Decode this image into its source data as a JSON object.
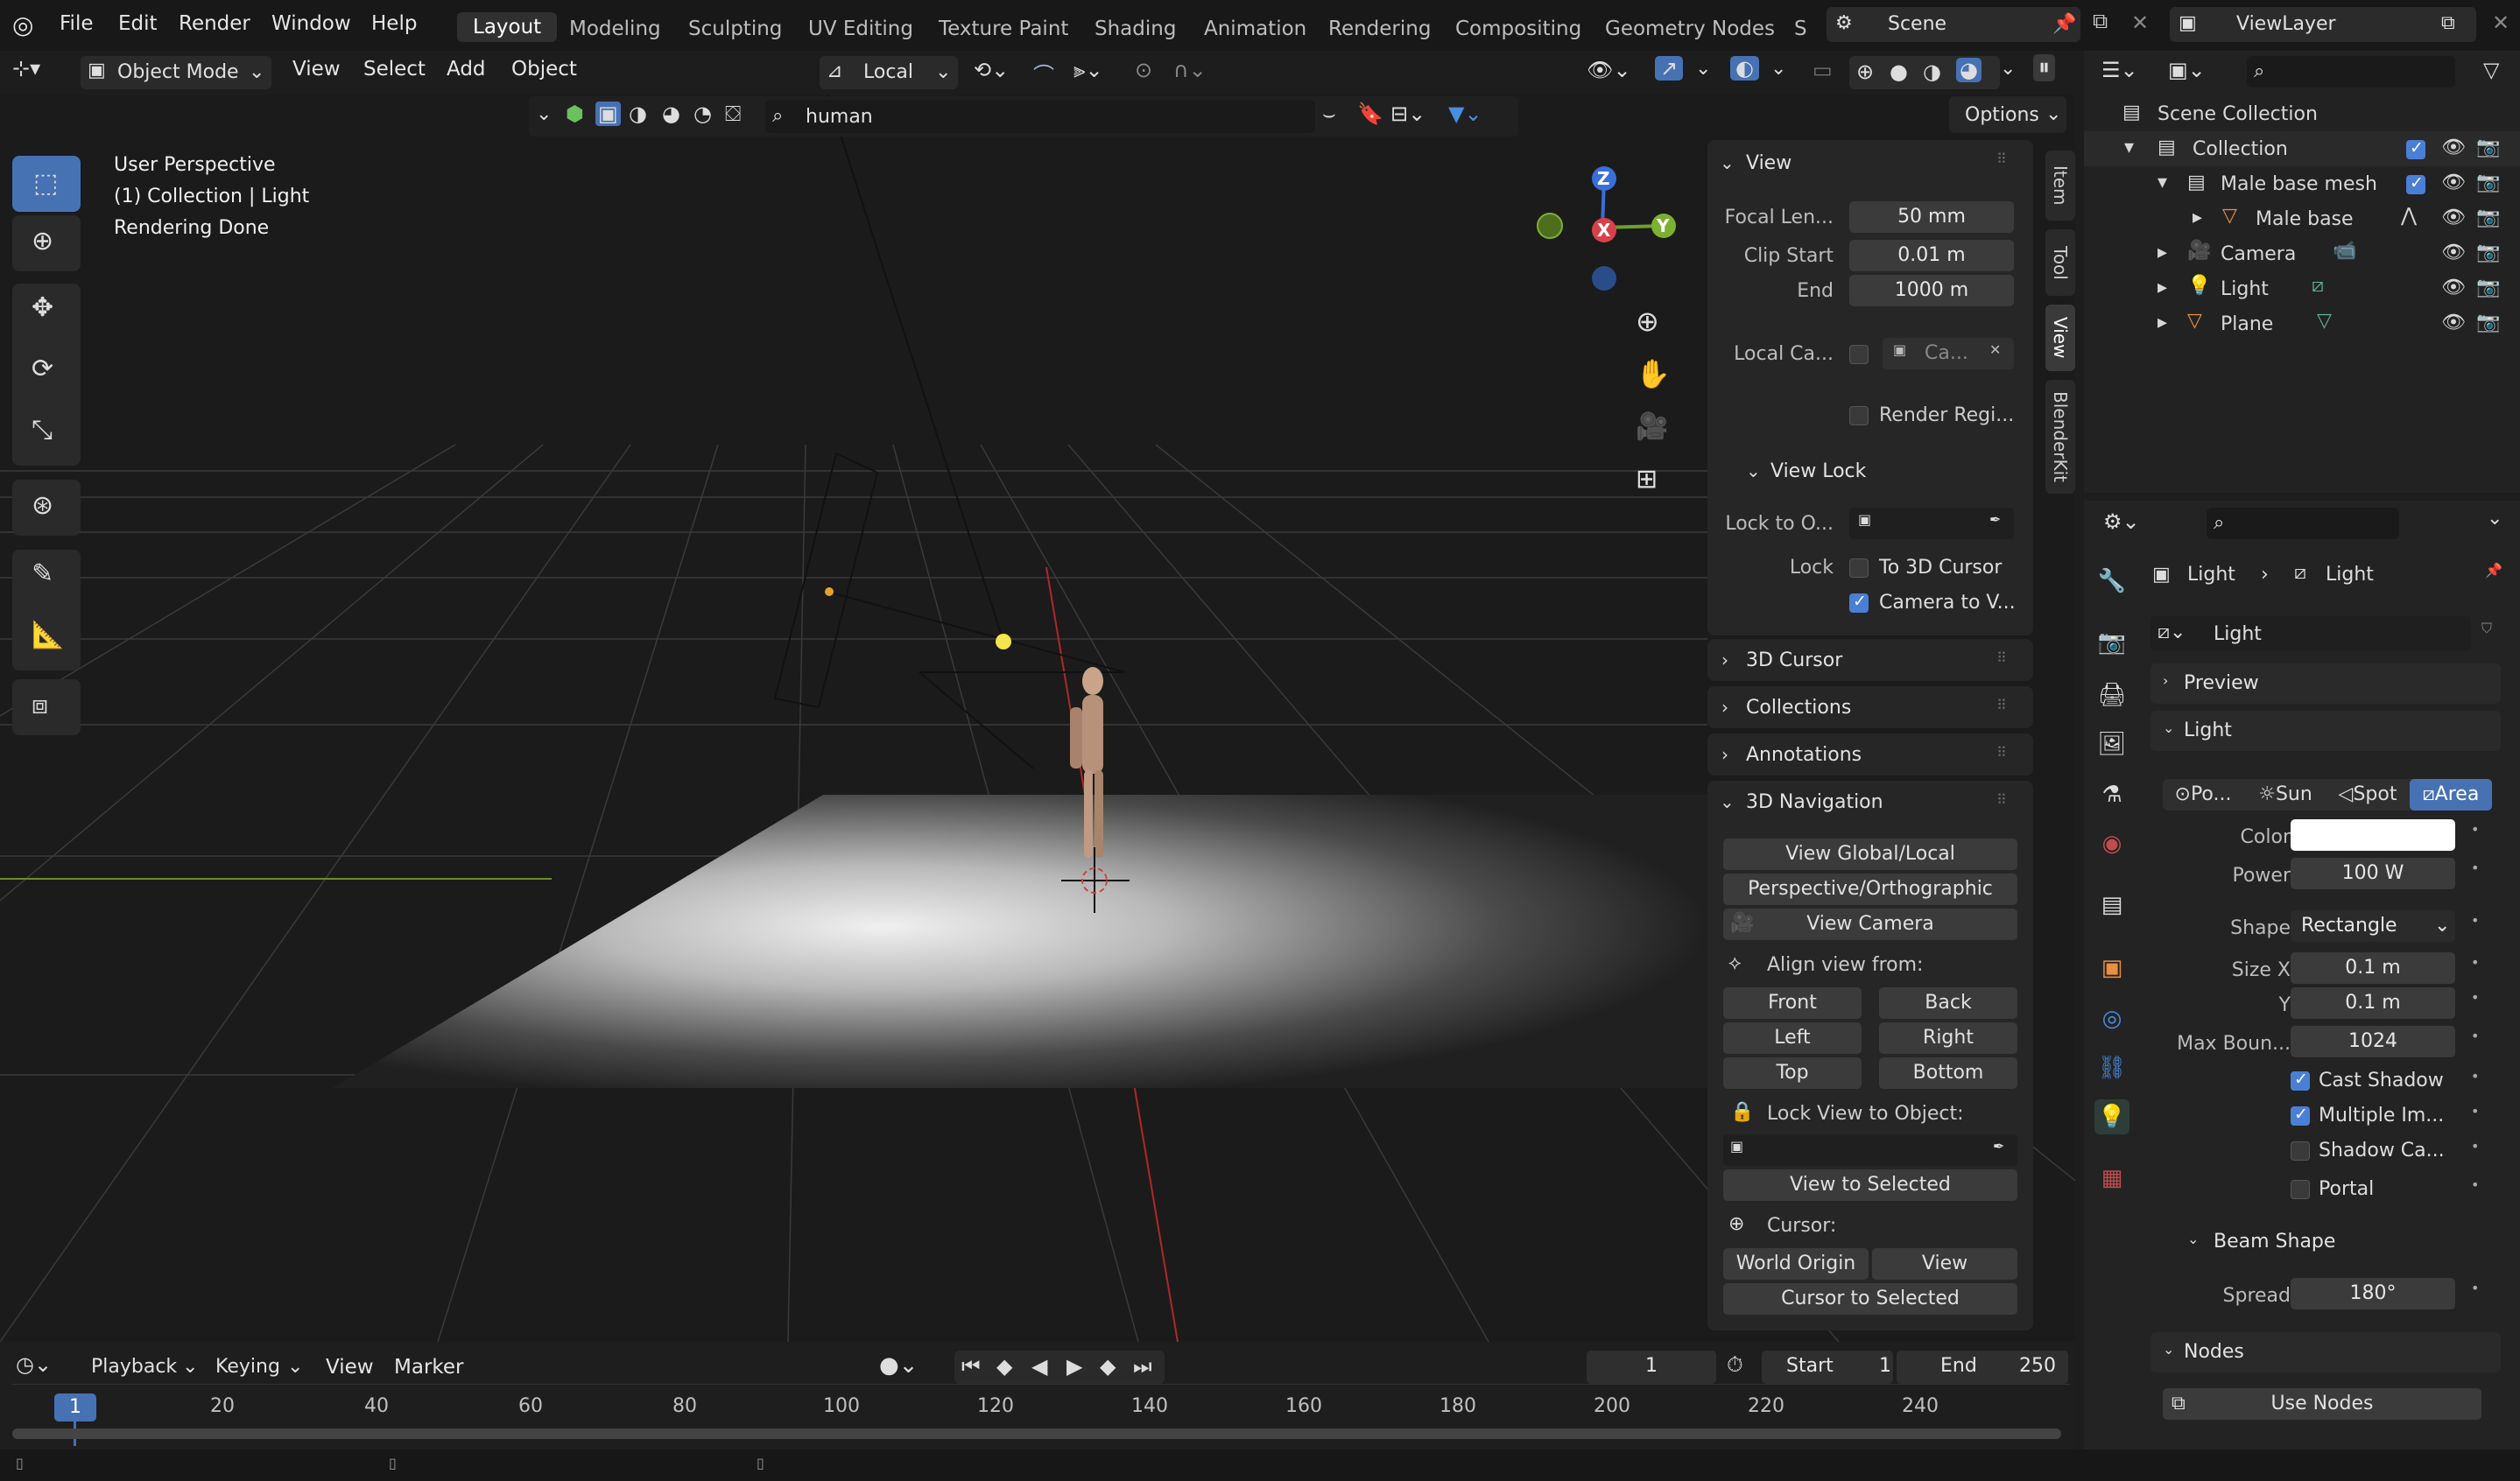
{
  "topbar": {
    "menus": [
      "File",
      "Edit",
      "Render",
      "Window",
      "Help"
    ],
    "workspaces": [
      "Layout",
      "Modeling",
      "Sculpting",
      "UV Editing",
      "Texture Paint",
      "Shading",
      "Animation",
      "Rendering",
      "Compositing",
      "Geometry Nodes",
      "S"
    ],
    "scene": "Scene",
    "view_layer": "ViewLayer"
  },
  "viewport_header": {
    "mode": "Object Mode",
    "menus": [
      "View",
      "Select",
      "Add",
      "Object"
    ],
    "transform_orientation": "Local",
    "search": "human",
    "options": "Options"
  },
  "overlay": {
    "line1": "User Perspective",
    "line2": "(1) Collection | Light",
    "line3": "Rendering Done"
  },
  "gizmo": {
    "z": "Z",
    "x": "X",
    "y": "Y"
  },
  "npanel": {
    "view_title": "View",
    "focal_label": "Focal Len...",
    "focal_value": "50 mm",
    "clip_start_label": "Clip Start",
    "clip_start_value": "0.01 m",
    "end_label": "End",
    "end_value": "1000 m",
    "local_cam_label": "Local Ca...",
    "local_cam_value": "Ca...",
    "render_region": "Render Regi...",
    "view_lock_title": "View Lock",
    "lock_to_obj_label": "Lock to O...",
    "lock_label": "Lock",
    "to_3d_cursor": "To 3D Cursor",
    "camera_to_view": "Camera to V...",
    "cursor_title": "3D Cursor",
    "collections_title": "Collections",
    "annotations_title": "Annotations",
    "nav_title": "3D Navigation",
    "view_global_local": "View Global/Local",
    "persp_ortho": "Perspective/Orthographic",
    "view_camera": "View Camera",
    "align_view_from": "Align view from:",
    "front": "Front",
    "back": "Back",
    "left": "Left",
    "right": "Right",
    "top": "Top",
    "bottom": "Bottom",
    "lock_view_to_object": "Lock View to Object:",
    "view_to_selected": "View to Selected",
    "cursor_label": "Cursor:",
    "world_origin": "World Origin",
    "view": "View",
    "cursor_to_selected": "Cursor to Selected"
  },
  "side_tabs": [
    "Item",
    "Tool",
    "View",
    "BlenderKit"
  ],
  "outliner": {
    "scene_collection": "Scene Collection",
    "collection": "Collection",
    "items": [
      {
        "name": "Male base mesh",
        "icon": "collection-icon"
      },
      {
        "name": "Male base",
        "icon": "mesh-icon"
      },
      {
        "name": "Camera",
        "icon": "camera-icon"
      },
      {
        "name": "Light",
        "icon": "light-icon"
      },
      {
        "name": "Plane",
        "icon": "mesh-icon"
      }
    ]
  },
  "properties": {
    "breadcrumb_obj": "Light",
    "breadcrumb_data": "Light",
    "datablock": "Light",
    "preview_title": "Preview",
    "light_title": "Light",
    "types": [
      "Po...",
      "Sun",
      "Spot",
      "Area"
    ],
    "color_label": "Color",
    "power_label": "Power",
    "power_value": "100 W",
    "shape_label": "Shape",
    "shape_value": "Rectangle",
    "sizex_label": "Size X",
    "sizex_value": "0.1 m",
    "y_label": "Y",
    "y_value": "0.1 m",
    "maxb_label": "Max Boun...",
    "maxb_value": "1024",
    "cast_shadow": "Cast Shadow",
    "multiple_im": "Multiple Im...",
    "shadow_ca": "Shadow Ca...",
    "portal": "Portal",
    "beam_title": "Beam Shape",
    "spread_label": "Spread",
    "spread_value": "180°",
    "nodes_title": "Nodes",
    "use_nodes": "Use Nodes"
  },
  "timeline": {
    "menus": [
      "Playback",
      "Keying",
      "View",
      "Marker"
    ],
    "current_frame": "1",
    "start_label": "Start",
    "start_value": "1",
    "end_label": "End",
    "end_value": "250",
    "ticks": [
      "1",
      "20",
      "40",
      "60",
      "80",
      "100",
      "120",
      "140",
      "160",
      "180",
      "200",
      "220",
      "240"
    ]
  }
}
